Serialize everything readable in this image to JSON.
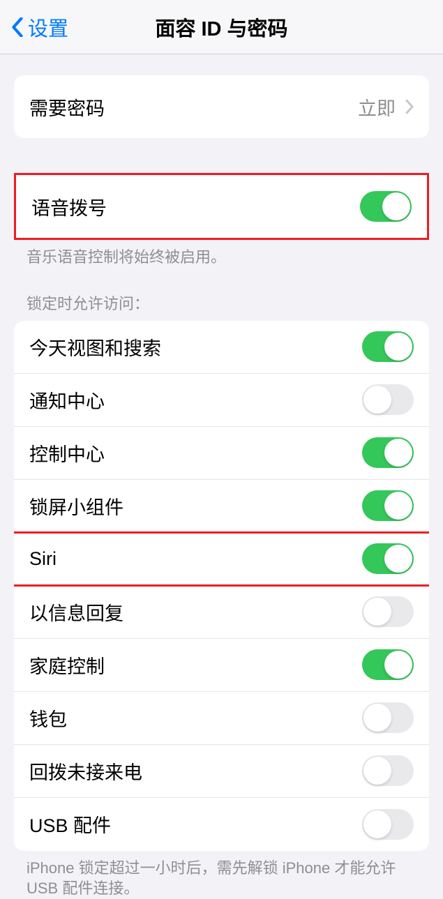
{
  "nav": {
    "back_label": "设置",
    "title": "面容 ID 与密码"
  },
  "require_passcode": {
    "label": "需要密码",
    "value": "立即"
  },
  "voice_dial": {
    "label": "语音拨号",
    "enabled": true,
    "footer": "音乐语音控制将始终被启用。"
  },
  "locked_access": {
    "header": "锁定时允许访问：",
    "items": [
      {
        "label": "今天视图和搜索",
        "enabled": true
      },
      {
        "label": "通知中心",
        "enabled": false
      },
      {
        "label": "控制中心",
        "enabled": true
      },
      {
        "label": "锁屏小组件",
        "enabled": true
      },
      {
        "label": "Siri",
        "enabled": true
      },
      {
        "label": "以信息回复",
        "enabled": false
      },
      {
        "label": "家庭控制",
        "enabled": true
      },
      {
        "label": "钱包",
        "enabled": false
      },
      {
        "label": "回拨未接来电",
        "enabled": false
      },
      {
        "label": "USB 配件",
        "enabled": false
      }
    ],
    "footer": "iPhone 锁定超过一小时后，需先解锁 iPhone 才能允许 USB 配件连接。"
  }
}
